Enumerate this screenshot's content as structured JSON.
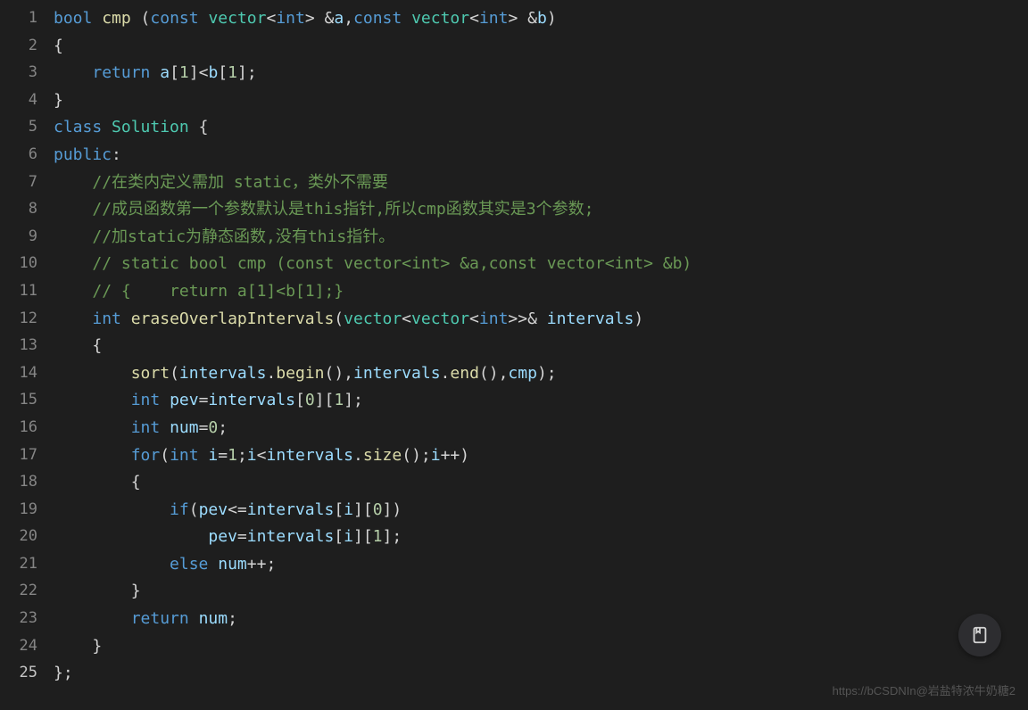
{
  "line_numbers": [
    "1",
    "2",
    "3",
    "4",
    "5",
    "6",
    "7",
    "8",
    "9",
    "10",
    "11",
    "12",
    "13",
    "14",
    "15",
    "16",
    "17",
    "18",
    "19",
    "20",
    "21",
    "22",
    "23",
    "24",
    "25"
  ],
  "active_line": 25,
  "watermark": "https://bCSDNIn@岩盐特浓牛奶糖2",
  "code_lines": [
    {
      "tokens": [
        {
          "t": "bool",
          "c": "k"
        },
        {
          "t": " "
        },
        {
          "t": "cmp",
          "c": "fn"
        },
        {
          "t": " ("
        },
        {
          "t": "const",
          "c": "k"
        },
        {
          "t": " "
        },
        {
          "t": "vector",
          "c": "t"
        },
        {
          "t": "<"
        },
        {
          "t": "int",
          "c": "k"
        },
        {
          "t": "> &"
        },
        {
          "t": "a",
          "c": "v"
        },
        {
          "t": ","
        },
        {
          "t": "const",
          "c": "k"
        },
        {
          "t": " "
        },
        {
          "t": "vector",
          "c": "t"
        },
        {
          "t": "<"
        },
        {
          "t": "int",
          "c": "k"
        },
        {
          "t": "> &"
        },
        {
          "t": "b",
          "c": "v"
        },
        {
          "t": ")"
        }
      ]
    },
    {
      "tokens": [
        {
          "t": "{"
        }
      ]
    },
    {
      "tokens": [
        {
          "t": "    "
        },
        {
          "t": "return",
          "c": "k"
        },
        {
          "t": " "
        },
        {
          "t": "a",
          "c": "v"
        },
        {
          "t": "["
        },
        {
          "t": "1",
          "c": "n"
        },
        {
          "t": "]<"
        },
        {
          "t": "b",
          "c": "v"
        },
        {
          "t": "["
        },
        {
          "t": "1",
          "c": "n"
        },
        {
          "t": "];"
        }
      ]
    },
    {
      "tokens": [
        {
          "t": "}"
        }
      ]
    },
    {
      "tokens": [
        {
          "t": "class",
          "c": "k"
        },
        {
          "t": " "
        },
        {
          "t": "Solution",
          "c": "t"
        },
        {
          "t": " {"
        }
      ]
    },
    {
      "tokens": [
        {
          "t": "public",
          "c": "k"
        },
        {
          "t": ":"
        }
      ]
    },
    {
      "tokens": [
        {
          "t": "    "
        },
        {
          "t": "//在类内定义需加 static，类外不需要",
          "c": "c"
        }
      ]
    },
    {
      "tokens": [
        {
          "t": "    "
        },
        {
          "t": "//成员函数第一个参数默认是this指针,所以cmp函数其实是3个参数;",
          "c": "c"
        }
      ]
    },
    {
      "tokens": [
        {
          "t": "    "
        },
        {
          "t": "//加static为静态函数,没有this指针。",
          "c": "c"
        }
      ]
    },
    {
      "tokens": [
        {
          "t": "    "
        },
        {
          "t": "// static bool cmp (const vector<int> &a,const vector<int> &b)",
          "c": "c"
        }
      ]
    },
    {
      "tokens": [
        {
          "t": "    "
        },
        {
          "t": "// {    return a[1]<b[1];}",
          "c": "c"
        }
      ]
    },
    {
      "tokens": [
        {
          "t": "    "
        },
        {
          "t": "int",
          "c": "k"
        },
        {
          "t": " "
        },
        {
          "t": "eraseOverlapIntervals",
          "c": "fn"
        },
        {
          "t": "("
        },
        {
          "t": "vector",
          "c": "t"
        },
        {
          "t": "<"
        },
        {
          "t": "vector",
          "c": "t"
        },
        {
          "t": "<"
        },
        {
          "t": "int",
          "c": "k"
        },
        {
          "t": ">>& "
        },
        {
          "t": "intervals",
          "c": "v"
        },
        {
          "t": ")"
        }
      ]
    },
    {
      "tokens": [
        {
          "t": "    {"
        }
      ]
    },
    {
      "tokens": [
        {
          "t": "        "
        },
        {
          "t": "sort",
          "c": "fn"
        },
        {
          "t": "("
        },
        {
          "t": "intervals",
          "c": "v"
        },
        {
          "t": "."
        },
        {
          "t": "begin",
          "c": "fn"
        },
        {
          "t": "(),"
        },
        {
          "t": "intervals",
          "c": "v"
        },
        {
          "t": "."
        },
        {
          "t": "end",
          "c": "fn"
        },
        {
          "t": "(),"
        },
        {
          "t": "cmp",
          "c": "v"
        },
        {
          "t": ");"
        }
      ]
    },
    {
      "tokens": [
        {
          "t": "        "
        },
        {
          "t": "int",
          "c": "k"
        },
        {
          "t": " "
        },
        {
          "t": "pev",
          "c": "v"
        },
        {
          "t": "="
        },
        {
          "t": "intervals",
          "c": "v"
        },
        {
          "t": "["
        },
        {
          "t": "0",
          "c": "n"
        },
        {
          "t": "]["
        },
        {
          "t": "1",
          "c": "n"
        },
        {
          "t": "];"
        }
      ]
    },
    {
      "tokens": [
        {
          "t": "        "
        },
        {
          "t": "int",
          "c": "k"
        },
        {
          "t": " "
        },
        {
          "t": "num",
          "c": "v"
        },
        {
          "t": "="
        },
        {
          "t": "0",
          "c": "n"
        },
        {
          "t": ";"
        }
      ]
    },
    {
      "tokens": [
        {
          "t": "        "
        },
        {
          "t": "for",
          "c": "k"
        },
        {
          "t": "("
        },
        {
          "t": "int",
          "c": "k"
        },
        {
          "t": " "
        },
        {
          "t": "i",
          "c": "v"
        },
        {
          "t": "="
        },
        {
          "t": "1",
          "c": "n"
        },
        {
          "t": ";"
        },
        {
          "t": "i",
          "c": "v"
        },
        {
          "t": "<"
        },
        {
          "t": "intervals",
          "c": "v"
        },
        {
          "t": "."
        },
        {
          "t": "size",
          "c": "fn"
        },
        {
          "t": "();"
        },
        {
          "t": "i",
          "c": "v"
        },
        {
          "t": "++)"
        }
      ]
    },
    {
      "tokens": [
        {
          "t": "        {"
        }
      ]
    },
    {
      "tokens": [
        {
          "t": "            "
        },
        {
          "t": "if",
          "c": "k"
        },
        {
          "t": "("
        },
        {
          "t": "pev",
          "c": "v"
        },
        {
          "t": "<="
        },
        {
          "t": "intervals",
          "c": "v"
        },
        {
          "t": "["
        },
        {
          "t": "i",
          "c": "v"
        },
        {
          "t": "]["
        },
        {
          "t": "0",
          "c": "n"
        },
        {
          "t": "])"
        }
      ]
    },
    {
      "tokens": [
        {
          "t": "                "
        },
        {
          "t": "pev",
          "c": "v"
        },
        {
          "t": "="
        },
        {
          "t": "intervals",
          "c": "v"
        },
        {
          "t": "["
        },
        {
          "t": "i",
          "c": "v"
        },
        {
          "t": "]["
        },
        {
          "t": "1",
          "c": "n"
        },
        {
          "t": "];"
        }
      ]
    },
    {
      "tokens": [
        {
          "t": "            "
        },
        {
          "t": "else",
          "c": "k"
        },
        {
          "t": " "
        },
        {
          "t": "num",
          "c": "v"
        },
        {
          "t": "++;"
        }
      ]
    },
    {
      "tokens": [
        {
          "t": "        }"
        }
      ]
    },
    {
      "tokens": [
        {
          "t": "        "
        },
        {
          "t": "return",
          "c": "k"
        },
        {
          "t": " "
        },
        {
          "t": "num",
          "c": "v"
        },
        {
          "t": ";"
        }
      ]
    },
    {
      "tokens": [
        {
          "t": "    }"
        }
      ]
    },
    {
      "tokens": [
        {
          "t": "};"
        }
      ]
    }
  ]
}
